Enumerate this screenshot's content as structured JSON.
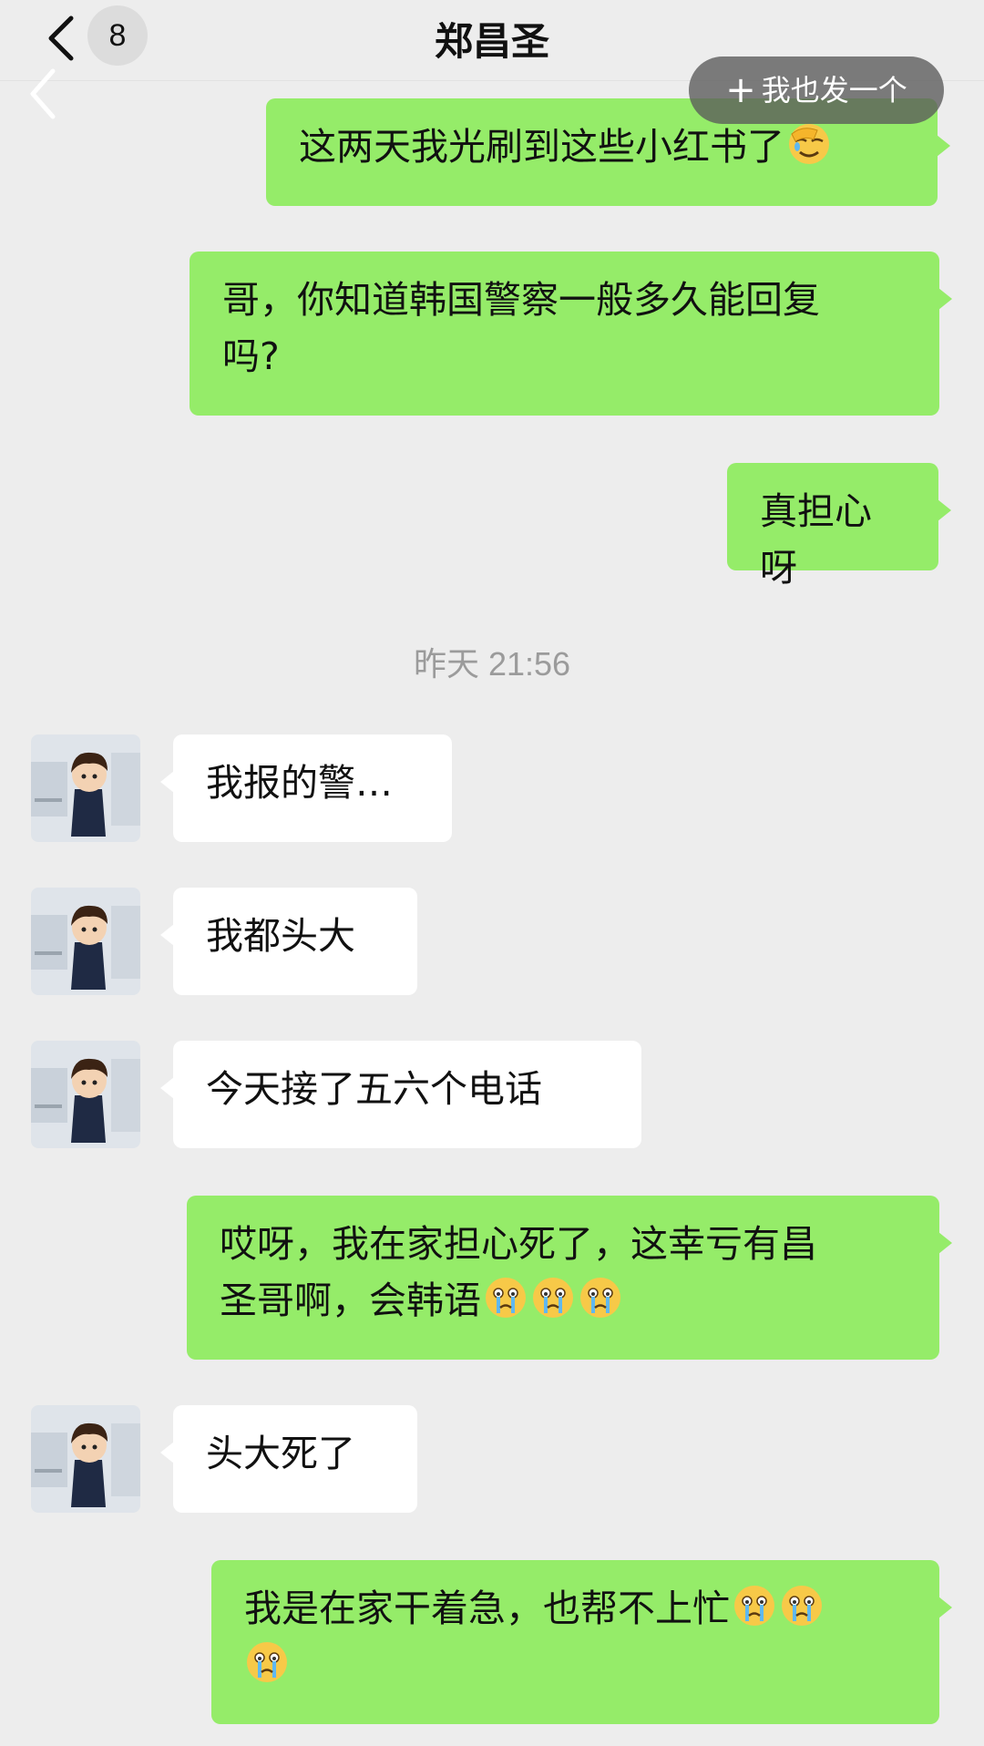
{
  "header": {
    "back_badge": "8",
    "title": "郑昌圣",
    "me_too_button": "我也发一个"
  },
  "messages": {
    "m1": "这两天我光刷到这些小红书了",
    "m2_line1": "哥，你知道韩国警察一般多久能回复",
    "m2_line2": "吗?",
    "m3": "真担心呀",
    "timestamp": "昨天 21:56",
    "m4": "我报的警…",
    "m5": "我都头大",
    "m6": "今天接了五六个电话",
    "m7_line1": "哎呀，我在家担心死了，这幸亏有昌",
    "m7_line2": "圣哥啊，会韩语",
    "m8": "头大死了",
    "m9_line1": "我是在家干着急，也帮不上忙"
  }
}
